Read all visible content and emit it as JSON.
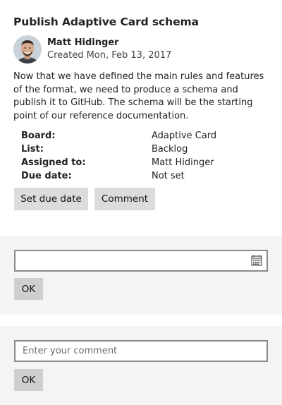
{
  "card": {
    "title": "Publish Adaptive Card schema",
    "author": {
      "name": "Matt Hidinger",
      "created": "Created Mon, Feb 13, 2017",
      "avatar_icon": "user-avatar"
    },
    "description": "Now that we have defined the main rules and features of the format, we need to produce a schema and publish it to GitHub. The schema will be the starting point of our reference documentation.",
    "facts": [
      {
        "key": "Board:",
        "value": "Adaptive Card"
      },
      {
        "key": "List:",
        "value": "Backlog"
      },
      {
        "key": "Assigned to:",
        "value": "Matt Hidinger"
      },
      {
        "key": "Due date:",
        "value": "Not set"
      }
    ],
    "actions": {
      "set_due_date": "Set due date",
      "comment": "Comment"
    }
  },
  "due_date_panel": {
    "value": "",
    "calendar_icon": "calendar-icon",
    "ok_label": "OK"
  },
  "comment_panel": {
    "placeholder": "Enter your comment",
    "value": "",
    "ok_label": "OK"
  },
  "colors": {
    "panel_bg": "#f4f4f4",
    "button_bg": "#dcdcdc",
    "input_border": "#8a8a8a"
  }
}
